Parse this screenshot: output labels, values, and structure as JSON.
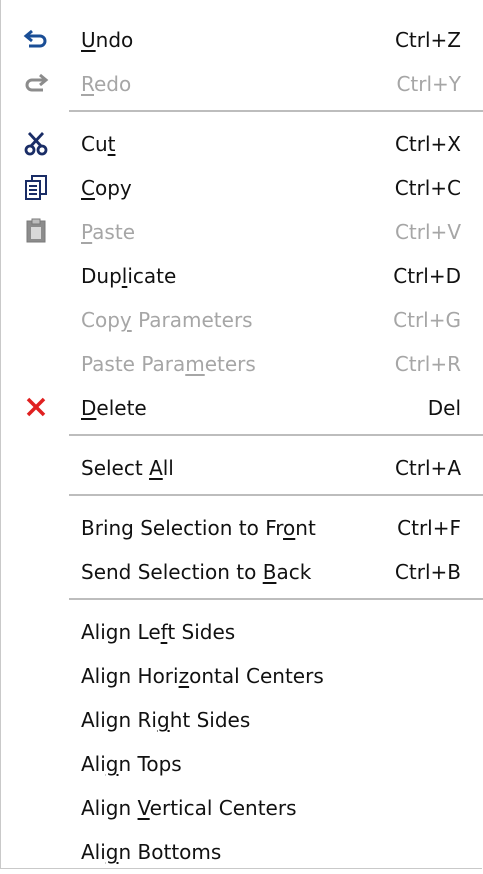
{
  "menu": {
    "items": [
      {
        "pre": "",
        "acc": "U",
        "post": "ndo",
        "shortcut": "Ctrl+Z",
        "enabled": true,
        "icon": "undo-icon"
      },
      {
        "pre": "",
        "acc": "R",
        "post": "edo",
        "shortcut": "Ctrl+Y",
        "enabled": false,
        "icon": "redo-icon"
      },
      {
        "pre": "Cu",
        "acc": "t",
        "post": "",
        "shortcut": "Ctrl+X",
        "enabled": true,
        "icon": "cut-icon"
      },
      {
        "pre": "",
        "acc": "C",
        "post": "opy",
        "shortcut": "Ctrl+C",
        "enabled": true,
        "icon": "copy-icon"
      },
      {
        "pre": "",
        "acc": "P",
        "post": "aste",
        "shortcut": "Ctrl+V",
        "enabled": false,
        "icon": "paste-icon"
      },
      {
        "pre": "Dup",
        "acc": "l",
        "post": "icate",
        "shortcut": "Ctrl+D",
        "enabled": true
      },
      {
        "pre": "Cop",
        "acc": "y",
        "post": " Parameters",
        "shortcut": "Ctrl+G",
        "enabled": false
      },
      {
        "pre": "Paste Para",
        "acc": "m",
        "post": "eters",
        "shortcut": "Ctrl+R",
        "enabled": false
      },
      {
        "pre": "",
        "acc": "D",
        "post": "elete",
        "shortcut": "Del",
        "enabled": true,
        "icon": "delete-icon"
      },
      {
        "pre": "Select ",
        "acc": "A",
        "post": "ll",
        "shortcut": "Ctrl+A",
        "enabled": true
      },
      {
        "pre": "Bring Selection to Fr",
        "acc": "o",
        "post": "nt",
        "shortcut": "Ctrl+F",
        "enabled": true
      },
      {
        "pre": "Send Selection to ",
        "acc": "B",
        "post": "ack",
        "shortcut": "Ctrl+B",
        "enabled": true
      },
      {
        "pre": "Align Le",
        "acc": "f",
        "post": "t Sides",
        "shortcut": "",
        "enabled": true
      },
      {
        "pre": "Align Hori",
        "acc": "z",
        "post": "ontal Centers",
        "shortcut": "",
        "enabled": true
      },
      {
        "pre": "Align Ri",
        "acc": "g",
        "post": "ht Sides",
        "shortcut": "",
        "enabled": true
      },
      {
        "pre": "Ali",
        "acc": "g",
        "post": "n Tops",
        "shortcut": "",
        "enabled": true
      },
      {
        "pre": "Align ",
        "acc": "V",
        "post": "ertical Centers",
        "shortcut": "",
        "enabled": true
      },
      {
        "pre": "Ali",
        "acc": "g",
        "post": "n Bottoms",
        "shortcut": "",
        "enabled": true
      }
    ]
  },
  "colors": {
    "undo_icon": "#1a4e96",
    "delete_icon": "#e02020",
    "disabled_text": "#a6a6a6",
    "separator": "#bdbdbd"
  }
}
